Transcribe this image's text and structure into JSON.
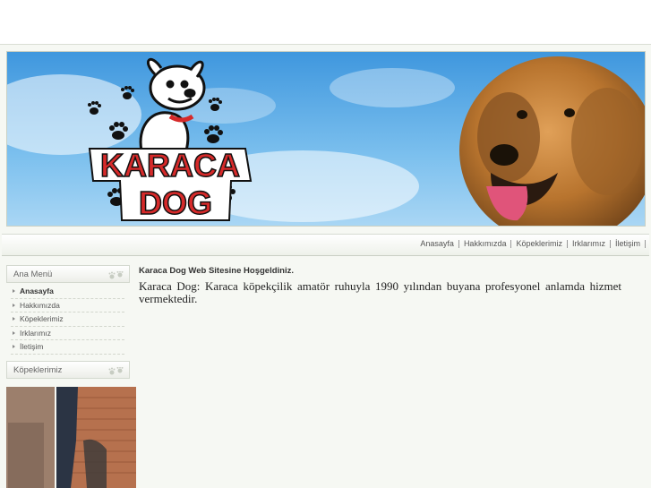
{
  "banner": {
    "logo_line1": "KARACA",
    "logo_line2": "DOG"
  },
  "nav": {
    "items": [
      "Anasayfa",
      "Hakkımızda",
      "Köpeklerimiz",
      "Irklarımız",
      "İletişim"
    ]
  },
  "sidebar": {
    "menu_title": "Ana Menü",
    "menu_items": [
      {
        "label": "Anasayfa",
        "active": true
      },
      {
        "label": "Hakkımızda",
        "active": false
      },
      {
        "label": "Köpeklerimiz",
        "active": false
      },
      {
        "label": "Irklarımız",
        "active": false
      },
      {
        "label": "İletişim",
        "active": false
      }
    ],
    "dogs_title": "Köpeklerimiz"
  },
  "content": {
    "heading": "Karaca Dog Web Sitesine Hoşgeldiniz.",
    "body": "Karaca Dog: Karaca köpekçilik amatör ruhuyla 1990 yılından buyana profesyonel anlamda hizmet vermektedir."
  },
  "colors": {
    "logo_red": "#d62a2a",
    "sky_blue": "#5aa9e6",
    "page_bg": "#f6f8f3"
  }
}
